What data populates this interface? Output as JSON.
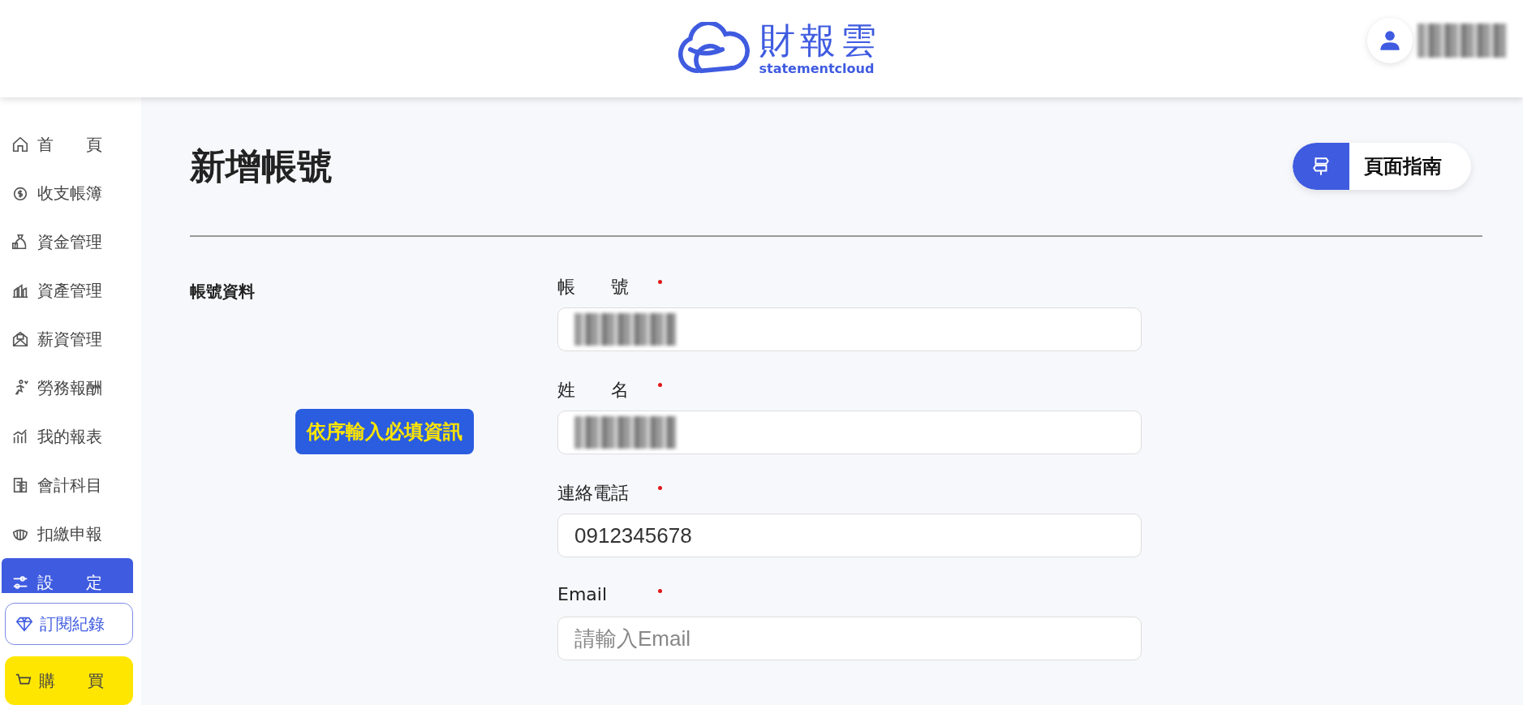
{
  "header": {
    "logo": {
      "name": "財報雲",
      "tagline": "statementcloud"
    },
    "user": {
      "name_redacted": true
    }
  },
  "sidebar": {
    "items": [
      {
        "label": "首　　頁",
        "selected": false
      },
      {
        "label": "收支帳簿",
        "selected": false
      },
      {
        "label": "資金管理",
        "selected": false
      },
      {
        "label": "資產管理",
        "selected": false
      },
      {
        "label": "薪資管理",
        "selected": false
      },
      {
        "label": "勞務報酬",
        "selected": false
      },
      {
        "label": "我的報表",
        "selected": false
      },
      {
        "label": "會計科目",
        "selected": false
      },
      {
        "label": "扣繳申報",
        "selected": false
      },
      {
        "label": "設　　定",
        "selected": true
      }
    ],
    "subscription_button": "訂閱紀錄",
    "buy_button": "購　　買"
  },
  "page": {
    "title": "新增帳號",
    "guide_button": "頁面指南",
    "section_label": "帳號資料",
    "fields": [
      {
        "label": "帳　　號",
        "required": true,
        "redacted": true
      },
      {
        "label": "姓　　名",
        "required": true,
        "redacted": true
      },
      {
        "label": "連絡電話",
        "required": true,
        "value": "0912345678"
      },
      {
        "label": "Email",
        "required": true,
        "placeholder": "請輸入Email"
      }
    ],
    "tooltip": "依序輸入必填資訊"
  }
}
